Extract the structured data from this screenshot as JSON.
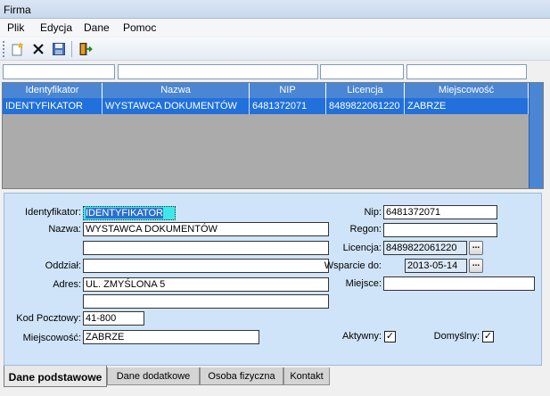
{
  "window": {
    "title": "Firma"
  },
  "menu": [
    "Plik",
    "Edycja",
    "Dane",
    "Pomoc"
  ],
  "toolbar": {
    "icons": [
      "new-document-icon",
      "delete-icon",
      "save-icon",
      "exit-door-icon"
    ]
  },
  "grid": {
    "columns": [
      "Identyfikator",
      "Nazwa",
      "NIP",
      "Licencja",
      "Miejscowość"
    ],
    "rows": [
      [
        "IDENTYFIKATOR",
        "WYSTAWCA DOKUMENTÓW",
        "6481372071",
        "8489822061220",
        "ZABRZE"
      ]
    ]
  },
  "form": {
    "labels": {
      "identyfikator": "Identyfikator:",
      "nazwa": "Nazwa:",
      "oddzial": "Oddział:",
      "adres": "Adres:",
      "kod": "Kod Pocztowy:",
      "miejscowosc": "Miejscowość:",
      "nip": "Nip:",
      "regon": "Regon:",
      "licencja": "Licencja:",
      "wsparcie": "Wsparcie do:",
      "miejsce": "Miejsce:",
      "aktywny": "Aktywny:",
      "domyslny": "Domyślny:"
    },
    "values": {
      "identyfikator": "IDENTYFIKATOR",
      "nazwa1": "WYSTAWCA DOKUMENTÓW",
      "nazwa2": "",
      "oddzial": "",
      "adres1": "UL. ZMYŚLONA 5",
      "adres2": "",
      "kod": "41-800",
      "miejscowosc": "ZABRZE",
      "nip": "6481372071",
      "regon": "",
      "licencja": "8489822061220",
      "wsparcie": "2013-05-14",
      "miejsce": "",
      "aktywny": true,
      "domyslny": true
    },
    "dots_label": "...",
    "check_mark": "✓"
  },
  "tabs": [
    "Dane podstawowe",
    "Dane dodatkowe",
    "Osoba fizyczna",
    "Kontakt"
  ],
  "colors": {
    "grid_header": "#4a86d4",
    "selected_row": "#2170db",
    "panel_bg": "#cfe4f8"
  }
}
